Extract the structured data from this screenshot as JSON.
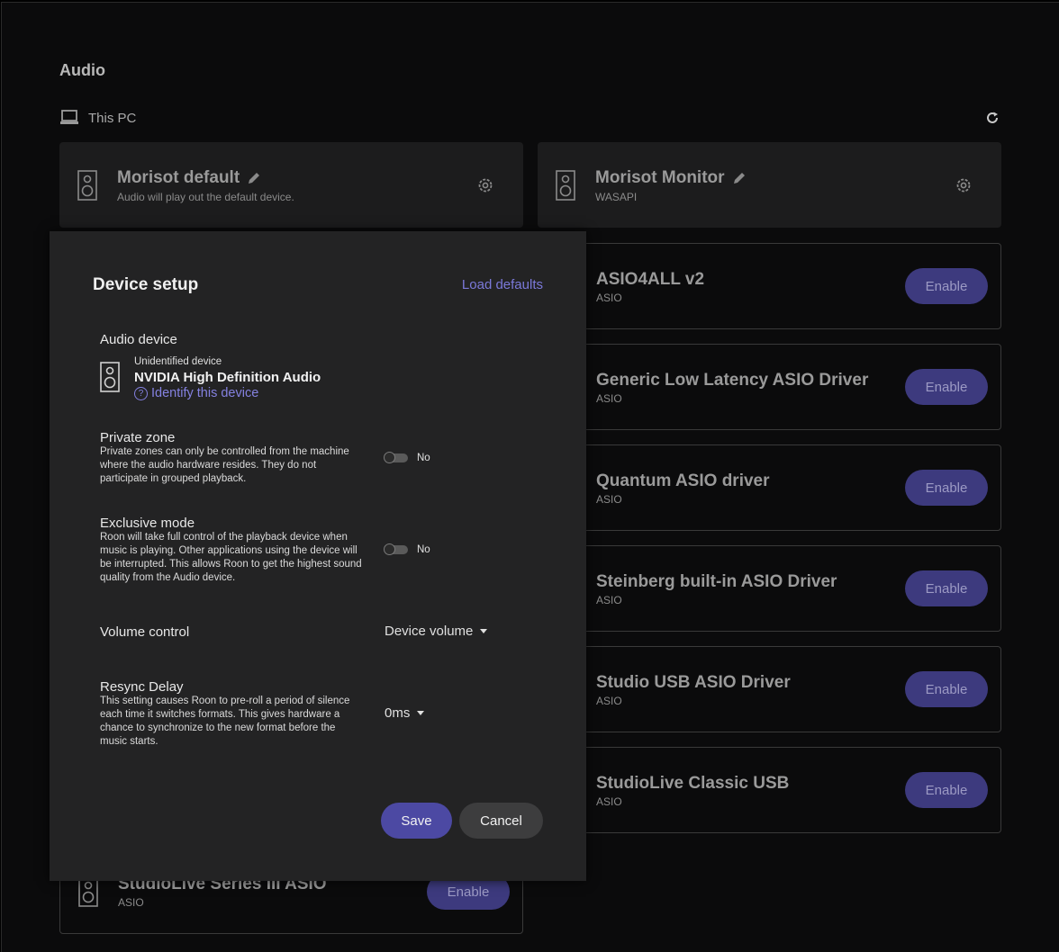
{
  "page": {
    "title": "Audio"
  },
  "source": {
    "label": "This PC",
    "icon": "laptop-icon",
    "refresh_icon": "refresh-icon"
  },
  "enabled_devices": [
    {
      "name": "Morisot default",
      "subtitle": "Audio will play out the default device."
    },
    {
      "name": "Morisot Monitor",
      "subtitle": "WASAPI"
    }
  ],
  "available_devices": [
    {
      "name": "ASIO4ALL v2",
      "subtitle": "ASIO",
      "action": "Enable"
    },
    {
      "name": "Generic Low Latency ASIO Driver",
      "subtitle": "ASIO",
      "action": "Enable"
    },
    {
      "name": "Quantum ASIO driver",
      "subtitle": "ASIO",
      "action": "Enable"
    },
    {
      "name": "Steinberg built-in ASIO Driver",
      "subtitle": "ASIO",
      "action": "Enable"
    },
    {
      "name": "Studio USB ASIO Driver",
      "subtitle": "ASIO",
      "action": "Enable"
    },
    {
      "name": "StudioLive Classic USB",
      "subtitle": "ASIO",
      "action": "Enable"
    },
    {
      "name": "StudioLive Series III ASIO",
      "subtitle": "ASIO",
      "action": "Enable"
    }
  ],
  "modal": {
    "title": "Device setup",
    "load_defaults": "Load defaults",
    "audio_device": {
      "label": "Audio device",
      "status": "Unidentified device",
      "name": "NVIDIA High Definition Audio",
      "identify_link": "Identify this device"
    },
    "private_zone": {
      "label": "Private zone",
      "description": "Private zones can only be controlled from the machine where the audio hardware resides. They do not participate in grouped playback.",
      "value": "No"
    },
    "exclusive_mode": {
      "label": "Exclusive mode",
      "description": "Roon will take full control of the playback device when music is playing. Other applications using the device will be interrupted. This allows Roon to get the highest sound quality from the Audio device.",
      "value": "No"
    },
    "volume_control": {
      "label": "Volume control",
      "value": "Device volume"
    },
    "resync_delay": {
      "label": "Resync Delay",
      "description": "This setting causes Roon to pre-roll a period of silence each time it switches formats. This gives hardware a chance to synchronize to the new format before the music starts.",
      "value": "0ms"
    },
    "save_label": "Save",
    "cancel_label": "Cancel"
  }
}
